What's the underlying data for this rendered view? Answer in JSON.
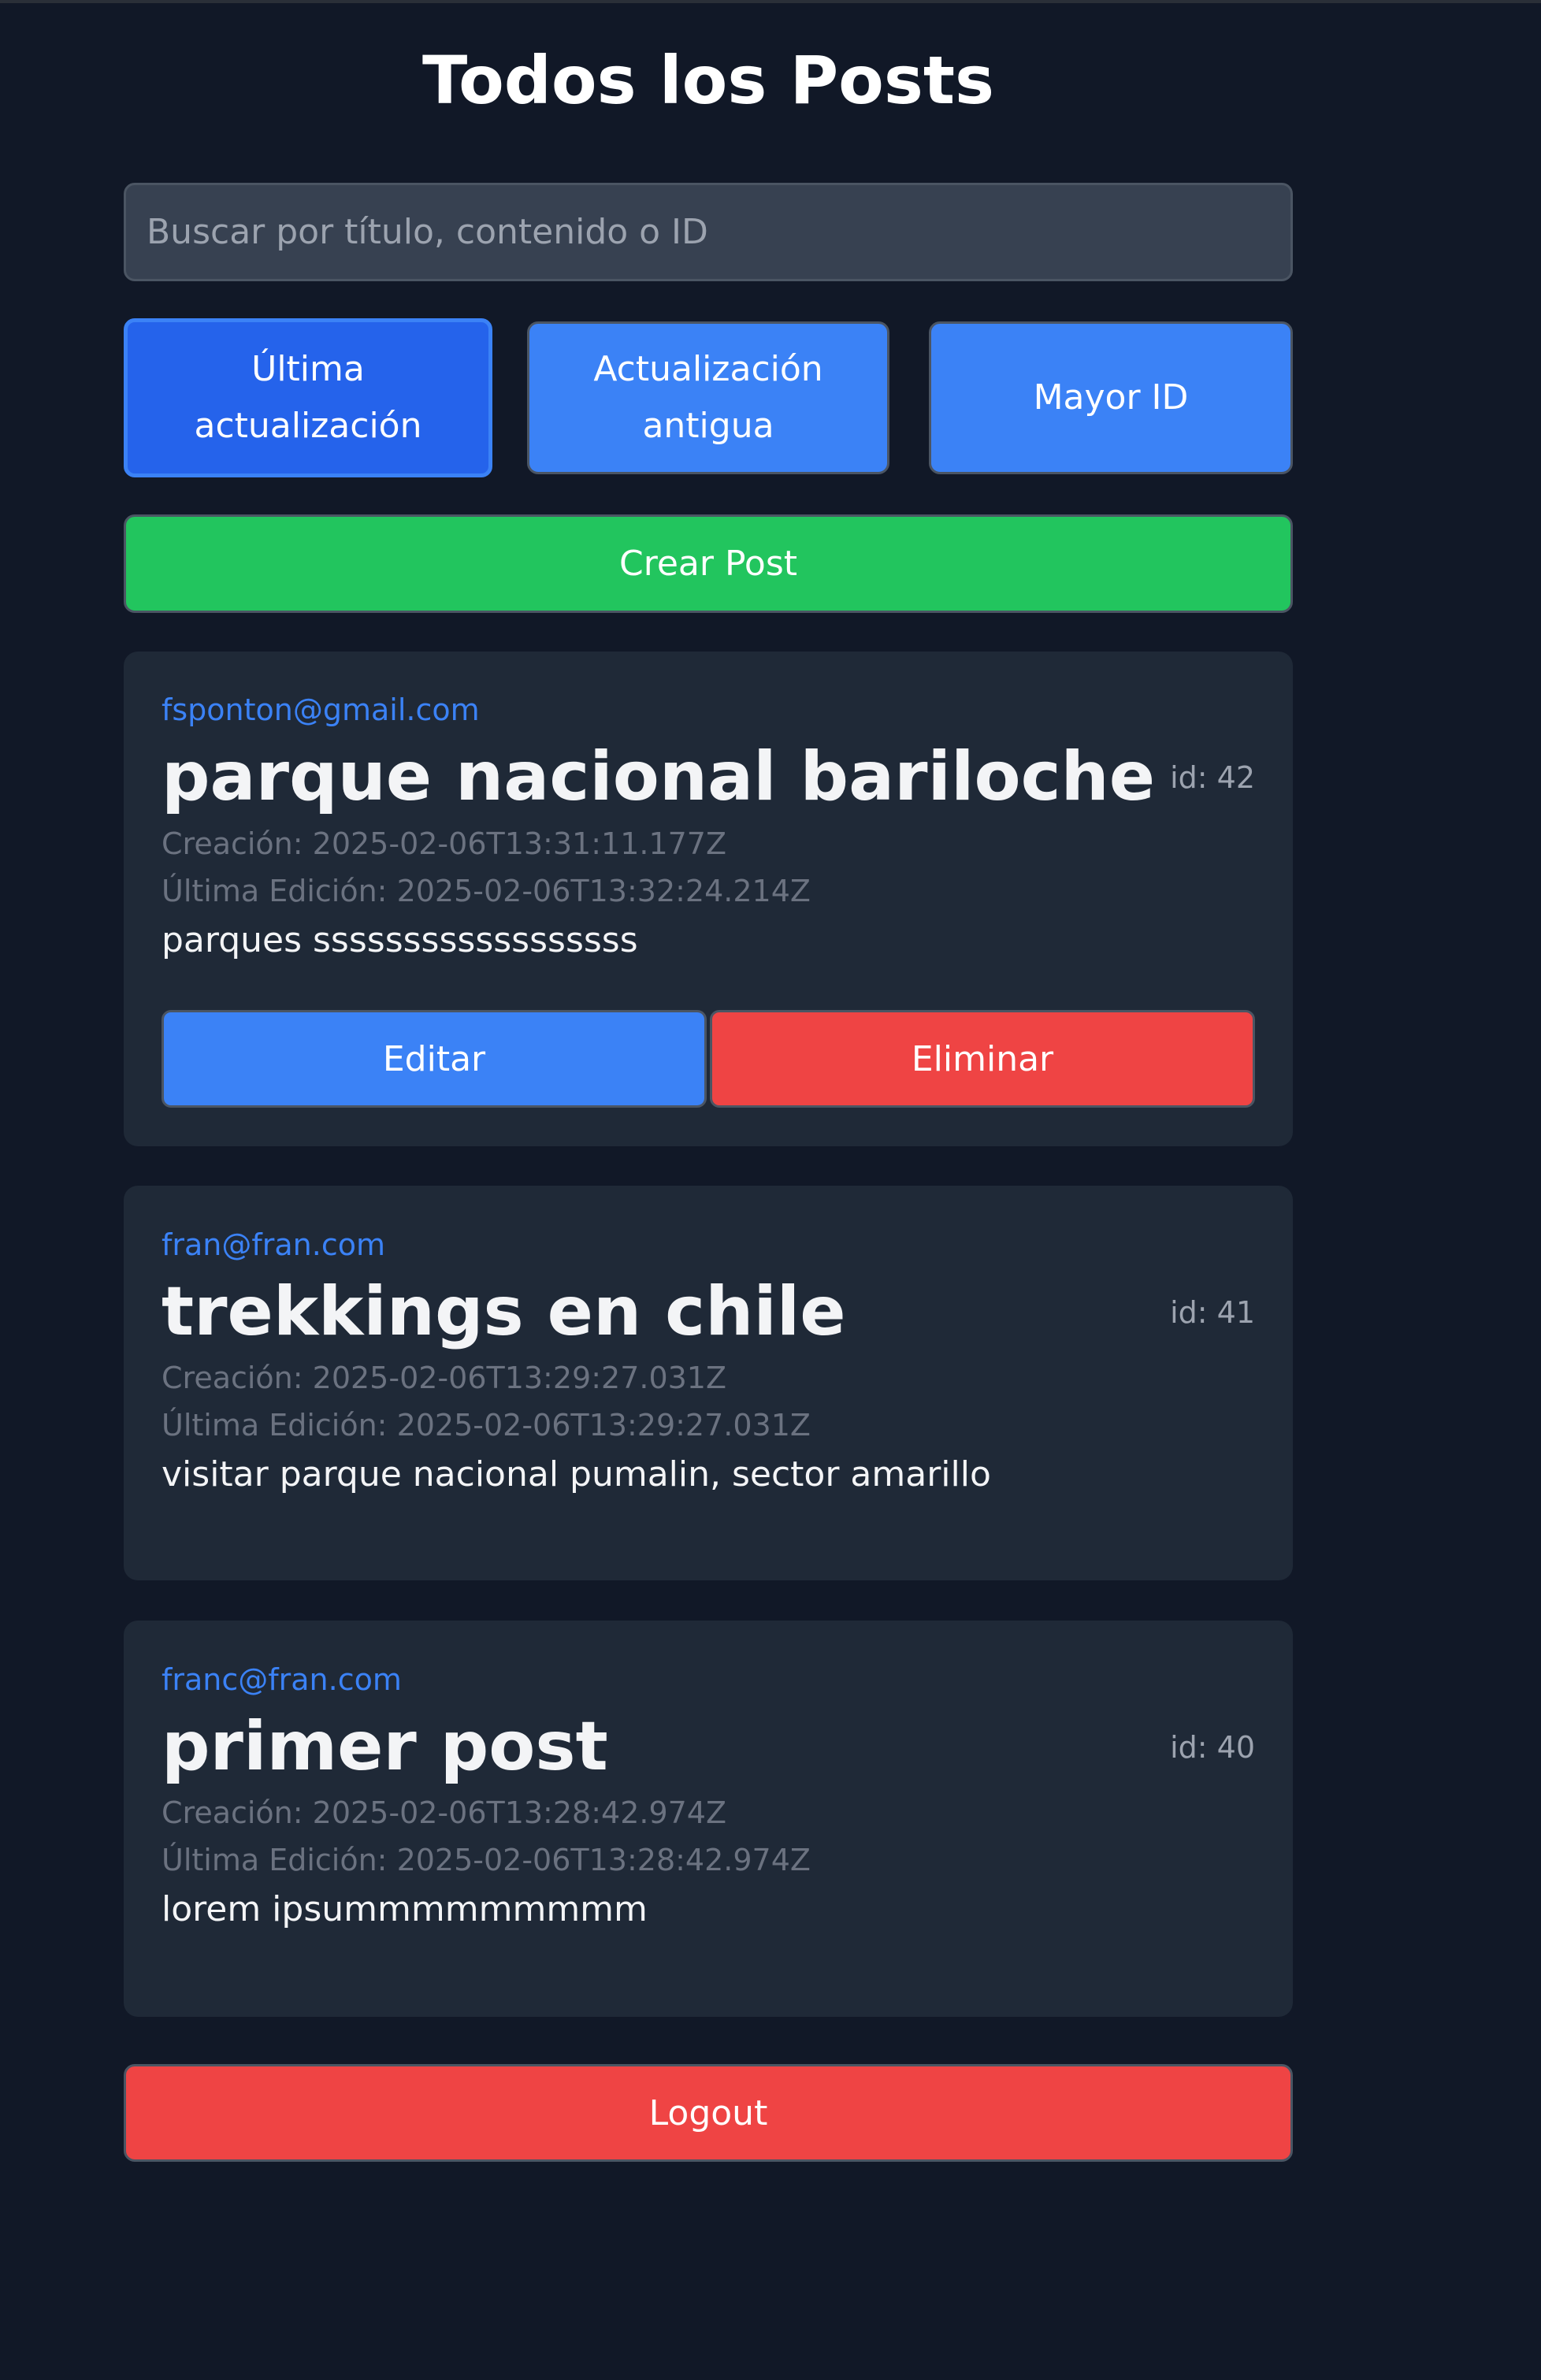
{
  "page": {
    "title": "Todos los Posts"
  },
  "search": {
    "placeholder": "Buscar por título, contenido o ID",
    "value": ""
  },
  "sort": {
    "options": [
      {
        "label": "Última actualización",
        "active": true
      },
      {
        "label": "Actualización antigua",
        "active": false
      },
      {
        "label": "Mayor ID",
        "active": false
      }
    ]
  },
  "actions": {
    "create_label": "Crear Post",
    "logout_label": "Logout"
  },
  "posts": [
    {
      "author": "fsponton@gmail.com",
      "title": "parque nacional bariloche",
      "id_label": "id: 42",
      "created": "Creación: 2025-02-06T13:31:11.177Z",
      "edited": "Última Edición: 2025-02-06T13:32:24.214Z",
      "body": "parques ssssssssssssssssss",
      "edit_label": "Editar",
      "delete_label": "Eliminar"
    },
    {
      "author": "fran@fran.com",
      "title": "trekkings en chile",
      "id_label": "id: 41",
      "created": "Creación: 2025-02-06T13:29:27.031Z",
      "edited": "Última Edición: 2025-02-06T13:29:27.031Z",
      "body": "visitar parque nacional pumalin, sector amarillo"
    },
    {
      "author": "franc@fran.com",
      "title": "primer post",
      "id_label": "id: 40",
      "created": "Creación: 2025-02-06T13:28:42.974Z",
      "edited": "Última Edición: 2025-02-06T13:28:42.974Z",
      "body": "lorem ipsummmmmmmmm"
    }
  ],
  "colors": {
    "background": "#111827",
    "card": "#1f2937",
    "primary": "#3b82f6",
    "primary_active": "#2563eb",
    "success": "#22c55e",
    "danger": "#ef4444",
    "author": "#3b82f6",
    "muted": "#6b7280"
  }
}
